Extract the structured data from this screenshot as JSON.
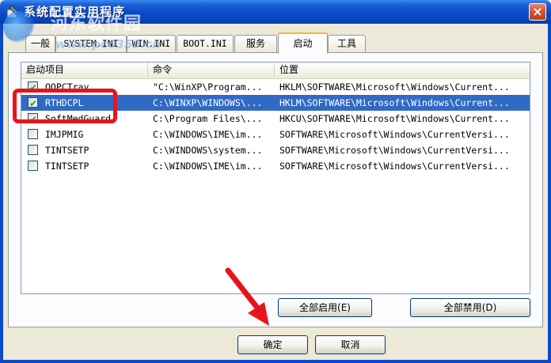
{
  "window": {
    "title": "系统配置实用程序",
    "close_glyph": "×",
    "watermark_line1": "河东软件园",
    "watermark_line2": "www.pc0359.cn"
  },
  "tabs": [
    {
      "label": "一般",
      "active": false
    },
    {
      "label": "SYSTEM.INI",
      "active": false
    },
    {
      "label": "WIN.INI",
      "active": false
    },
    {
      "label": "BOOT.INI",
      "active": false
    },
    {
      "label": "服务",
      "active": false
    },
    {
      "label": "启动",
      "active": true
    },
    {
      "label": "工具",
      "active": false
    }
  ],
  "list": {
    "columns": [
      "启动项目",
      "命令",
      "位置"
    ],
    "rows": [
      {
        "checked": true,
        "item": "QQPCTray",
        "command": "\"C:\\WinXP\\Program...",
        "location": "HKLM\\SOFTWARE\\Microsoft\\Windows\\Current...",
        "selected": false
      },
      {
        "checked": true,
        "item": "RTHDCPL",
        "command": "C:\\WINXP\\WINDOWS\\...",
        "location": "HKLM\\SOFTWARE\\Microsoft\\Windows\\Current...",
        "selected": true
      },
      {
        "checked": true,
        "item": "SoftMedGuard",
        "command": "C:\\Program Files\\...",
        "location": "HKCU\\SOFTWARE\\Microsoft\\Windows\\Current...",
        "selected": false
      },
      {
        "checked": false,
        "item": "IMJPMIG",
        "command": "C:\\WINDOWS\\IME\\im...",
        "location": "SOFTWARE\\Microsoft\\Windows\\CurrentVersi...",
        "selected": false
      },
      {
        "checked": false,
        "item": "TINTSETP",
        "command": "C:\\WINDOWS\\system...",
        "location": "SOFTWARE\\Microsoft\\Windows\\CurrentVersi...",
        "selected": false
      },
      {
        "checked": false,
        "item": "TINTSETP",
        "command": "C:\\WINDOWS\\IME\\im...",
        "location": "SOFTWARE\\Microsoft\\Windows\\CurrentVersi...",
        "selected": false
      }
    ]
  },
  "buttons": {
    "enable_all": "全部启用(E)",
    "disable_all": "全部禁用(D)",
    "ok": "确定",
    "cancel": "取消"
  },
  "colors": {
    "titlebar": "#0a49c9",
    "selection": "#316ac5",
    "annotation_red": "#e8141d"
  }
}
